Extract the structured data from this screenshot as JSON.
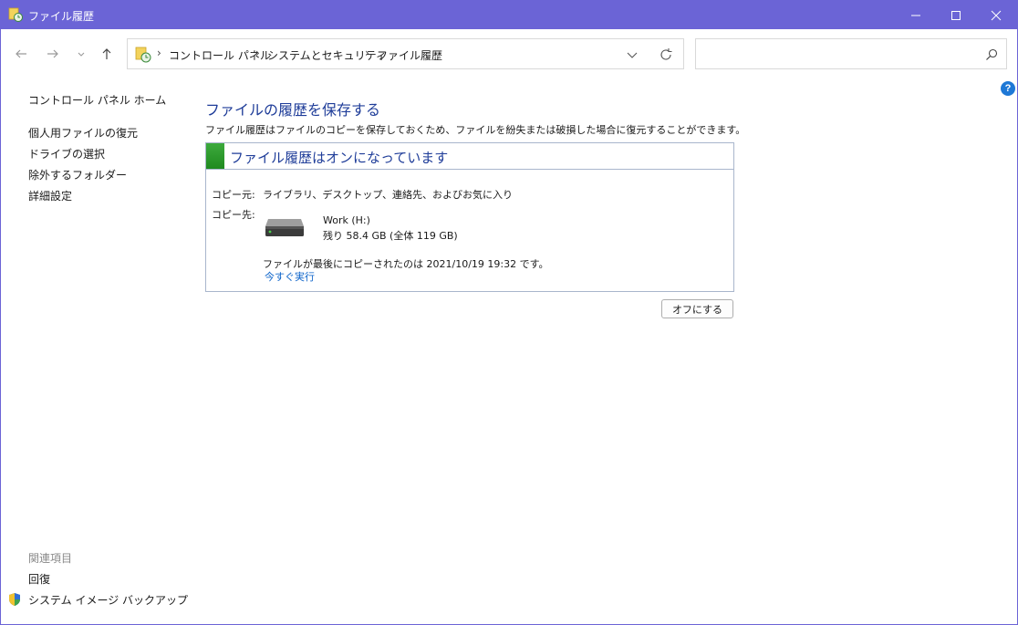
{
  "window": {
    "title": "ファイル履歴"
  },
  "address": {
    "breadcrumbs": [
      "コントロール パネル",
      "システムとセキュリティ",
      "ファイル履歴"
    ],
    "search_placeholder": ""
  },
  "sidebar": {
    "home": "コントロール パネル ホーム",
    "items": [
      "個人用ファイルの復元",
      "ドライブの選択",
      "除外するフォルダー",
      "詳細設定"
    ],
    "related_heading": "関連項目",
    "related": [
      "回復",
      "システム イメージ バックアップ"
    ]
  },
  "main": {
    "title": "ファイルの履歴を保存する",
    "description": "ファイル履歴はファイルのコピーを保存しておくため、ファイルを紛失または破損した場合に復元することができます。",
    "status_title": "ファイル履歴はオンになっています",
    "copy_from_label": "コピー元:",
    "copy_from_value": "ライブラリ、デスクトップ、連絡先、およびお気に入り",
    "copy_to_label": "コピー先:",
    "drive_name": "Work (H:)",
    "drive_space": "残り 58.4 GB (全体 119 GB)",
    "last_copied": "ファイルが最後にコピーされたのは 2021/10/19 19:32 です。",
    "run_now": "今すぐ実行",
    "off_button": "オフにする"
  },
  "help": "?",
  "colors": {
    "titlebar": "#6b64d6",
    "link_heading": "#1f3d99",
    "link": "#0a62c9",
    "status_green": "#2e9b2e"
  },
  "icons": [
    "file-history-icon",
    "minimize-icon",
    "maximize-icon",
    "close-icon",
    "back-arrow-icon",
    "forward-arrow-icon",
    "recent-dropdown-icon",
    "up-arrow-icon",
    "chevron-down-icon",
    "refresh-icon",
    "search-icon",
    "help-icon",
    "drive-icon",
    "shield-icon"
  ]
}
